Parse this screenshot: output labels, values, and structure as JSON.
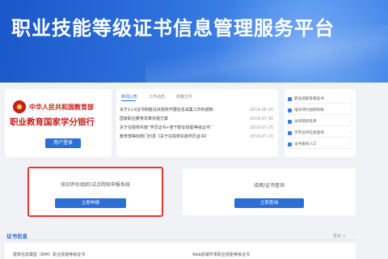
{
  "banner": {
    "title": "职业技能等级证书信息管理服务平台"
  },
  "logo_card": {
    "ministry": "中华人民共和国教育部",
    "bank": "职业教育国家学分银行",
    "login_label": "用户登录"
  },
  "news": {
    "tabs": [
      "新闻公告",
      "工作动态",
      "政策文件"
    ],
    "items": [
      {
        "title": "关于1+X证书制度试点院校开展信息采集工作的通知",
        "date": "2019-08-20"
      },
      {
        "title": "国家职业教育改革实施方案",
        "date": "2019-07-30"
      },
      {
        "title": "关于在院校实施“学历证书+若干职业技能等级证书”",
        "date": "2019-07-25"
      },
      {
        "title": "教育部等四部门印发《关于在院校实施学历证书》",
        "date": "2019-07-20"
      }
    ]
  },
  "side_links": [
    "职业技能等级证书",
    "培训评价组织机构",
    "试点院校名单",
    "学历证书信息查询",
    "证书查询入口"
  ],
  "apply": {
    "title": "培训评价组织/试点院校申报系统",
    "button": "立即申报"
  },
  "query": {
    "title": "成绩/证书查询",
    "button": "立即查询"
  },
  "certs": {
    "heading": "证书信息",
    "more": "更多 >",
    "items": [
      "建筑信息模型（BIM）职业技能等级证书",
      "Web前端开发职业技能等级证书"
    ]
  },
  "colors": {
    "primary": "#2c6fd6",
    "highlight_border": "#e8352d",
    "ministry_red": "#c8201e"
  }
}
